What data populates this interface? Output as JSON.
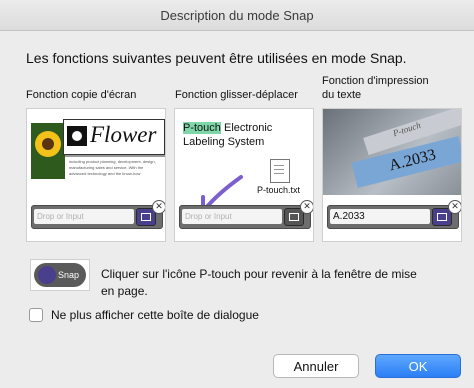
{
  "window": {
    "title": "Description du mode Snap"
  },
  "intro": "Les fonctions suivantes peuvent être utilisées en mode Snap.",
  "columns": [
    {
      "label_line1": "Fonction copie d'écran",
      "label_line2": ""
    },
    {
      "label_line1": "Fonction glisser-déplacer",
      "label_line2": ""
    },
    {
      "label_line1": "Fonction d'impression",
      "label_line2": "du texte"
    }
  ],
  "panel1": {
    "flower_text": "Flower",
    "blurb": "including product planning, development, design, manufacturing sales and service. With the advanced technology and the know-how",
    "snap_placeholder": "Drop or Input"
  },
  "panel2": {
    "highlight_word": "P-touch",
    "line1_rest": " Electronic",
    "line2": "Labeling System",
    "file_name": "P-touch.txt",
    "snap_placeholder": "Drop or Input"
  },
  "panel3": {
    "label_tape_text": "A.2033",
    "script_text": "P-touch",
    "snap_value": "A.2033"
  },
  "snap_icon_label": "Snap",
  "hint": {
    "line1": "Cliquer sur l'icône P-touch pour revenir à la fenêtre de mise",
    "line2": "en page."
  },
  "checkbox": {
    "label": "Ne plus afficher cette boîte de dialogue",
    "checked": false
  },
  "buttons": {
    "cancel": "Annuler",
    "ok": "OK"
  },
  "colors": {
    "ok_button": "#2a7ff5",
    "snap_button": "#4a3f8c",
    "highlight": "#7fd6a8",
    "tape": "#7aa6d6"
  }
}
